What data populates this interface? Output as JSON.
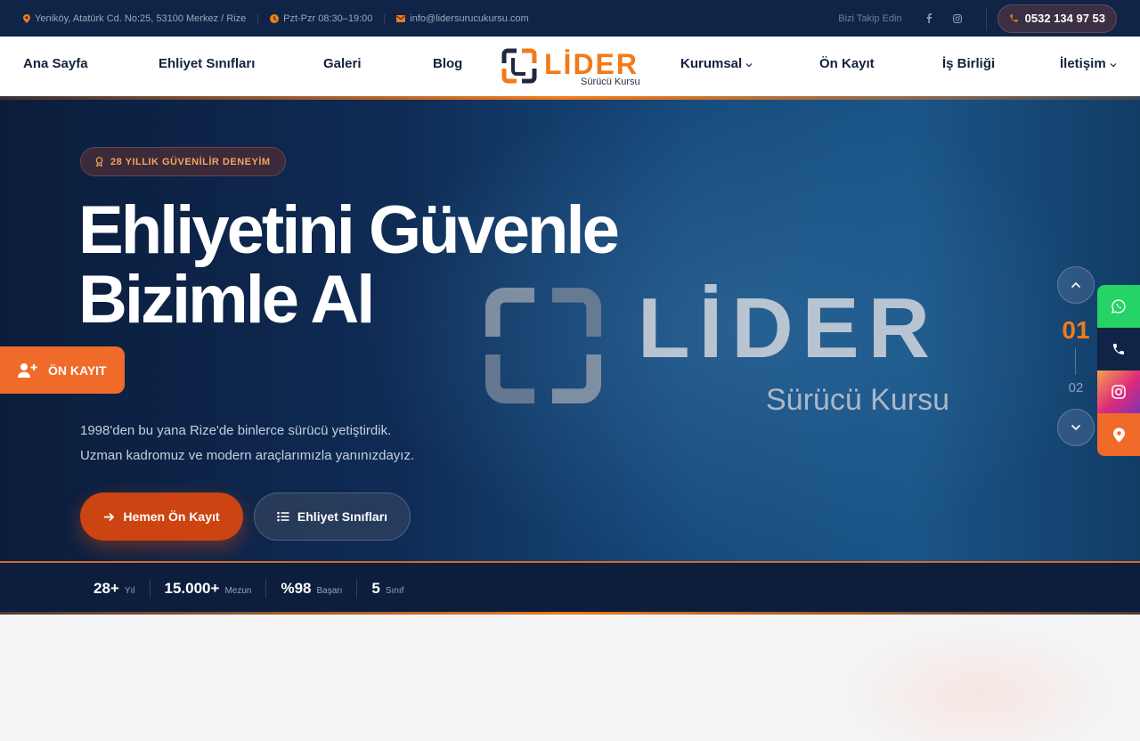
{
  "topbar": {
    "address": "Yeniköy, Atatürk Cd. No:25, 53100 Merkez / Rize",
    "hours": "Pzt-Pzr 08:30–19:00",
    "email": "info@lidersurucukursu.com",
    "follow_label": "Bizi Takip Edin",
    "phone": "0532 134 97 53"
  },
  "nav": {
    "items": [
      "Ana Sayfa",
      "Ehliyet Sınıfları",
      "Galeri",
      "Blog",
      "Kurumsal",
      "Ön Kayıt",
      "İş Birliği",
      "İletişim"
    ]
  },
  "logo": {
    "word": "LİDER",
    "sub": "Sürücü Kursu"
  },
  "hero": {
    "badge": "28 YILLIK GÜVENİLİR DENEYİM",
    "title": "Ehliyetini Güvenle Bizimle Al",
    "desc_line1": "1998'den bu yana Rize'de binlerce sürücü yetiştirdik.",
    "desc_line2": "Uzman kadromuz ve modern araçlarımızla yanınızdayız.",
    "btn_primary": "Hemen Ön Kayıt",
    "btn_secondary": "Ehliyet Sınıfları",
    "bg_logo_word": "LİDER",
    "bg_logo_sub": "Sürücü Kursu"
  },
  "floating": {
    "kayit_label": "ÖN KAYIT"
  },
  "slider": {
    "current": "01",
    "next": "02"
  },
  "stats": [
    {
      "num": "28+",
      "label": "Yıl"
    },
    {
      "num": "15.000+",
      "label": "Mezun"
    },
    {
      "num": "%98",
      "label": "Başarı"
    },
    {
      "num": "5",
      "label": "Sınıf"
    }
  ],
  "colors": {
    "accent": "#f27a1a",
    "navy": "#0f2446",
    "whatsapp": "#25d366"
  }
}
